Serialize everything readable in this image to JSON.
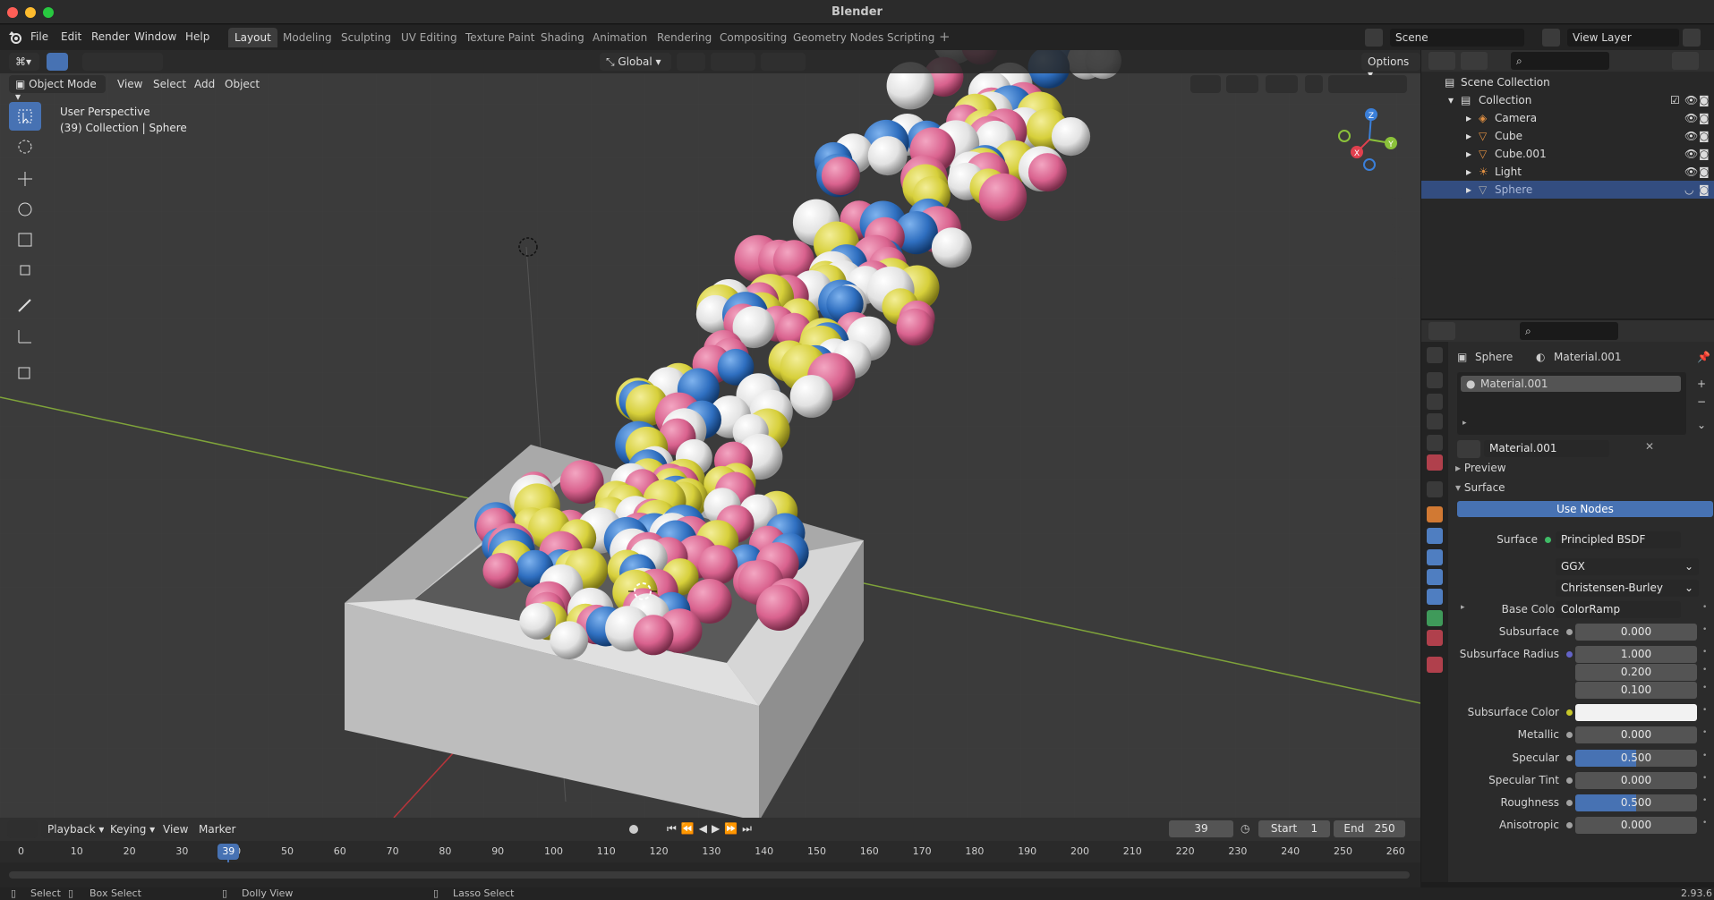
{
  "window": {
    "title": "Blender",
    "version": "2.93.6"
  },
  "menu": [
    "File",
    "Edit",
    "Render",
    "Window",
    "Help"
  ],
  "workspaces": [
    "Layout",
    "Modeling",
    "Sculpting",
    "UV Editing",
    "Texture Paint",
    "Shading",
    "Animation",
    "Rendering",
    "Compositing",
    "Geometry Nodes",
    "Scripting"
  ],
  "active_workspace": "Layout",
  "scene": {
    "name": "Scene",
    "view_layer": "View Layer"
  },
  "viewport": {
    "mode": "Object Mode",
    "menus": [
      "View",
      "Select",
      "Add",
      "Object"
    ],
    "transform_orientation": "Global",
    "options_label": "Options",
    "info_line1": "User Perspective",
    "info_line2": "(39) Collection | Sphere",
    "gizmo_axes": {
      "x": "X",
      "y": "Y",
      "z": "Z"
    }
  },
  "outliner": {
    "rows": [
      {
        "label": "Scene Collection",
        "level": 0
      },
      {
        "label": "Collection",
        "level": 1
      },
      {
        "label": "Camera",
        "level": 2
      },
      {
        "label": "Cube",
        "level": 2
      },
      {
        "label": "Cube.001",
        "level": 2
      },
      {
        "label": "Light",
        "level": 2
      },
      {
        "label": "Sphere",
        "level": 2,
        "selected": true
      }
    ]
  },
  "properties": {
    "object_name": "Sphere",
    "material_name": "Material.001",
    "slot_name": "Material.001",
    "datablock_name": "Material.001",
    "panel_preview": "Preview",
    "panel_surface": "Surface",
    "use_nodes_label": "Use Nodes",
    "surface_label": "Surface",
    "surface_shader": "Principled BSDF",
    "distribution": "GGX",
    "subsurface_method": "Christensen-Burley",
    "fields": [
      {
        "label": "Base Color",
        "value": "ColorRamp",
        "type": "link",
        "socket": "#c7c729"
      },
      {
        "label": "Subsurface",
        "value": "0.000",
        "type": "num",
        "socket": "#a1a1a1"
      },
      {
        "label": "Subsurface Radius",
        "value": "1.000",
        "type": "num",
        "socket": "#6363c7"
      },
      {
        "label": "",
        "value": "0.200",
        "type": "num"
      },
      {
        "label": "",
        "value": "0.100",
        "type": "num"
      },
      {
        "label": "Subsurface Color",
        "value": "",
        "type": "color",
        "socket": "#c7c729"
      },
      {
        "label": "Metallic",
        "value": "0.000",
        "type": "num",
        "socket": "#a1a1a1"
      },
      {
        "label": "Specular",
        "value": "0.500",
        "type": "slider",
        "fill": 0.5,
        "socket": "#a1a1a1"
      },
      {
        "label": "Specular Tint",
        "value": "0.000",
        "type": "num",
        "socket": "#a1a1a1"
      },
      {
        "label": "Roughness",
        "value": "0.500",
        "type": "slider",
        "fill": 0.5,
        "socket": "#a1a1a1"
      },
      {
        "label": "Anisotropic",
        "value": "0.000",
        "type": "num",
        "socket": "#a1a1a1"
      }
    ]
  },
  "timeline": {
    "menus": [
      "Playback",
      "Keying",
      "View",
      "Marker"
    ],
    "current_frame": "39",
    "start_label": "Start",
    "start": "1",
    "end_label": "End",
    "end": "250",
    "ticks": [
      "0",
      "10",
      "20",
      "30",
      "40",
      "50",
      "60",
      "70",
      "80",
      "90",
      "100",
      "110",
      "120",
      "130",
      "140",
      "150",
      "160",
      "170",
      "180",
      "190",
      "200",
      "210",
      "220",
      "230",
      "240",
      "250",
      "260"
    ]
  },
  "statusbar": {
    "select": "Select",
    "box_select": "Box Select",
    "dolly_view": "Dolly View",
    "lasso_select": "Lasso Select"
  },
  "colors": {
    "accent": "#4772b3",
    "ball_pink": "#d9628e",
    "ball_blue": "#2f6fc0",
    "ball_yellow": "#d6cf3a",
    "ball_white": "#e6e6e6"
  }
}
